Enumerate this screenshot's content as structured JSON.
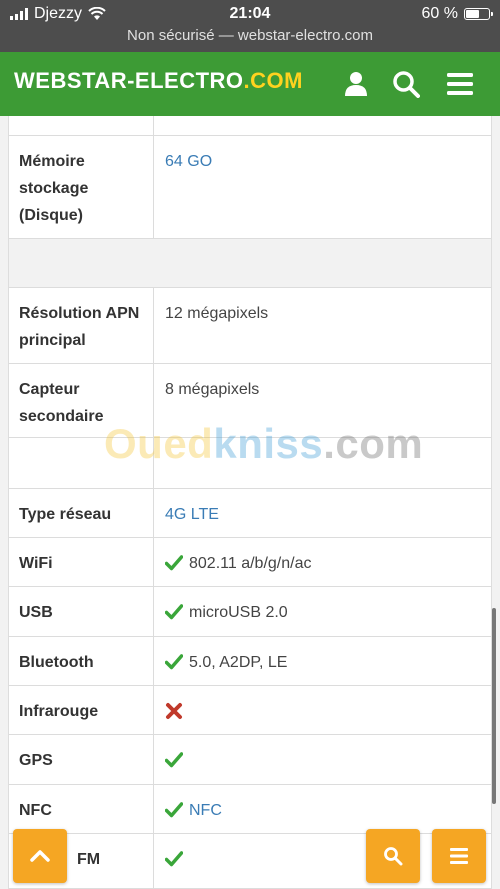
{
  "status_bar": {
    "carrier": "Djezzy",
    "time": "21:04",
    "battery_text": "60 %",
    "battery_level": 0.6,
    "url_text": "Non sécurisé — webstar-electro.com"
  },
  "header": {
    "logo_main": "WEBSTAR-ELECTRO",
    "logo_domain": ".COM",
    "icons": [
      "user-icon",
      "search-icon",
      "menu-icon"
    ]
  },
  "specs": {
    "storage": {
      "label": "Mémoire stockage (Disque)",
      "value": "64 GO"
    },
    "main_camera": {
      "label": "Résolution APN principal",
      "value": "12 mégapixels"
    },
    "secondary_sensor": {
      "label": "Capteur secondaire",
      "value": "8 mégapixels"
    },
    "network": {
      "label": "Type réseau",
      "value": "4G LTE"
    },
    "wifi": {
      "label": "WiFi",
      "value": "802.11 a/b/g/n/ac"
    },
    "usb": {
      "label": "USB",
      "value": "microUSB 2.0"
    },
    "bluetooth": {
      "label": "Bluetooth",
      "value": "5.0, A2DP, LE"
    },
    "infrared": {
      "label": "Infrarouge"
    },
    "gps": {
      "label": "GPS"
    },
    "nfc": {
      "label": "NFC",
      "value": "NFC"
    },
    "radio": {
      "label": "FM"
    }
  },
  "watermark": {
    "part1": "Oued",
    "part2": "kniss",
    "part3": ".com"
  },
  "colors": {
    "header_green": "#3d9b35",
    "logo_yellow": "#ffd21f",
    "fab_orange": "#f5a623",
    "check_green": "#3aa63a",
    "cross_red": "#c0392b",
    "link_blue": "#3a7cb5"
  }
}
